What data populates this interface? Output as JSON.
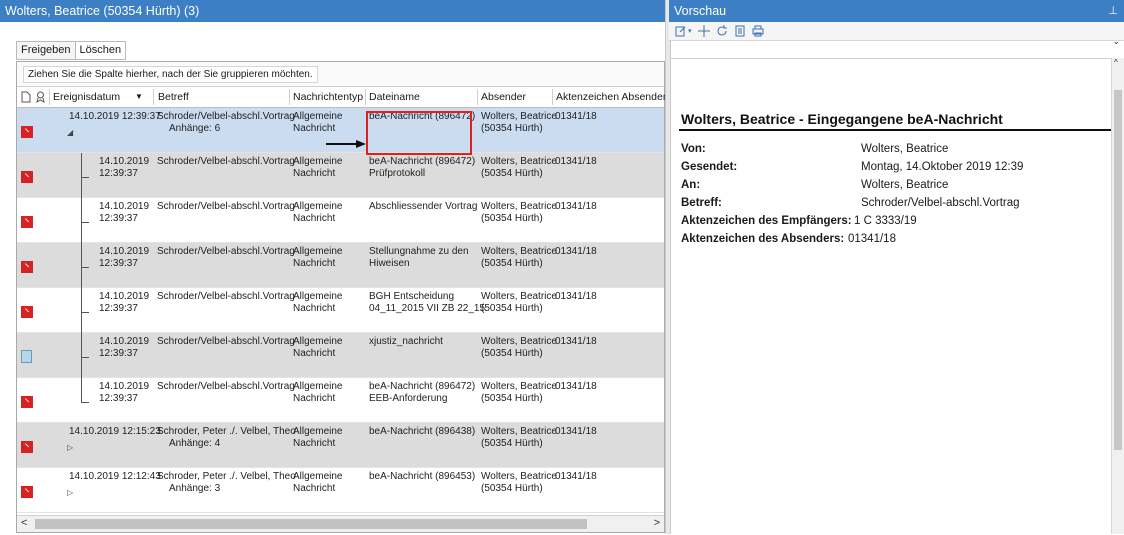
{
  "left_title": "Wolters, Beatrice (50354 Hürth) (3)",
  "right_title": "Vorschau",
  "toolbar": {
    "freigeben": "Freigeben",
    "loeschen": "Löschen"
  },
  "group_hint": "Ziehen Sie die Spalte hierher, nach der Sie gruppieren möchten.",
  "columns": {
    "ereignisdatum": "Ereignisdatum",
    "betreff": "Betreff",
    "nachrichtentyp": "Nachrichtentyp",
    "dateiname": "Dateiname",
    "absender": "Absender",
    "aktenzeichen": "Aktenzeichen Absender"
  },
  "rows": [
    {
      "date1": "14.10.2019 12:39:37",
      "date2": "",
      "betreff1": "Schroder/Velbel-abschl.Vortrag",
      "betreff2": "Anhänge: 6",
      "typ1": "Allgemeine",
      "typ2": "Nachricht",
      "datei1": "beA-Nachricht (896472)",
      "datei2": "",
      "abs1": "Wolters, Beatrice",
      "abs2": "(50354 Hürth)",
      "az": "01341/18",
      "icon": "pdf",
      "style": "sel",
      "level": 0
    },
    {
      "date1": "14.10.2019",
      "date2": "12:39:37",
      "betreff1": "Schroder/Velbel-abschl.Vortrag",
      "betreff2": "",
      "typ1": "Allgemeine",
      "typ2": "Nachricht",
      "datei1": "beA-Nachricht (896472)",
      "datei2": "Prüfprotokoll",
      "abs1": "Wolters, Beatrice",
      "abs2": "(50354 Hürth)",
      "az": "01341/18",
      "icon": "pdf",
      "style": "g",
      "level": 1
    },
    {
      "date1": "14.10.2019",
      "date2": "12:39:37",
      "betreff1": "Schroder/Velbel-abschl.Vortrag",
      "betreff2": "",
      "typ1": "Allgemeine",
      "typ2": "Nachricht",
      "datei1": "Abschliessender Vortrag",
      "datei2": "",
      "abs1": "Wolters, Beatrice",
      "abs2": "(50354 Hürth)",
      "az": "01341/18",
      "icon": "pdf",
      "style": "w",
      "level": 1
    },
    {
      "date1": "14.10.2019",
      "date2": "12:39:37",
      "betreff1": "Schroder/Velbel-abschl.Vortrag",
      "betreff2": "",
      "typ1": "Allgemeine",
      "typ2": "Nachricht",
      "datei1": "Stellungnahme zu den",
      "datei2": "Hiweisen",
      "abs1": "Wolters, Beatrice",
      "abs2": "(50354 Hürth)",
      "az": "01341/18",
      "icon": "pdf",
      "style": "g",
      "level": 1
    },
    {
      "date1": "14.10.2019",
      "date2": "12:39:37",
      "betreff1": "Schroder/Velbel-abschl.Vortrag",
      "betreff2": "",
      "typ1": "Allgemeine",
      "typ2": "Nachricht",
      "datei1": "BGH Entscheidung",
      "datei2": "04_11_2015 VII ZB 22_15",
      "abs1": "Wolters, Beatrice",
      "abs2": "(50354 Hürth)",
      "az": "01341/18",
      "icon": "pdf",
      "style": "w",
      "level": 1
    },
    {
      "date1": "14.10.2019",
      "date2": "12:39:37",
      "betreff1": "Schroder/Velbel-abschl.Vortrag",
      "betreff2": "",
      "typ1": "Allgemeine",
      "typ2": "Nachricht",
      "datei1": "xjustiz_nachricht",
      "datei2": "",
      "abs1": "Wolters, Beatrice",
      "abs2": "(50354 Hürth)",
      "az": "01341/18",
      "icon": "xml",
      "style": "g",
      "level": 1
    },
    {
      "date1": "14.10.2019",
      "date2": "12:39:37",
      "betreff1": "Schroder/Velbel-abschl.Vortrag",
      "betreff2": "",
      "typ1": "Allgemeine",
      "typ2": "Nachricht",
      "datei1": "beA-Nachricht (896472)",
      "datei2": "EEB-Anforderung",
      "abs1": "Wolters, Beatrice",
      "abs2": "(50354 Hürth)",
      "az": "01341/18",
      "icon": "pdf",
      "style": "w",
      "level": 1
    },
    {
      "date1": "14.10.2019 12:15:23",
      "date2": "",
      "betreff1": "Schroder, Peter ./. Velbel, Theo",
      "betreff2": "Anhänge: 4",
      "typ1": "Allgemeine",
      "typ2": "Nachricht",
      "datei1": "beA-Nachricht (896438)",
      "datei2": "",
      "abs1": "Wolters, Beatrice",
      "abs2": "(50354 Hürth)",
      "az": "01341/18",
      "icon": "pdf",
      "style": "g",
      "level": 0
    },
    {
      "date1": "14.10.2019 12:12:43",
      "date2": "",
      "betreff1": "Schroder, Peter ./. Velbel, Theo",
      "betreff2": "Anhänge: 3",
      "typ1": "Allgemeine",
      "typ2": "Nachricht",
      "datei1": "beA-Nachricht (896453)",
      "datei2": "",
      "abs1": "Wolters, Beatrice",
      "abs2": "(50354 Hürth)",
      "az": "01341/18",
      "icon": "pdf",
      "style": "w",
      "level": 0
    }
  ],
  "preview": {
    "title": "Wolters, Beatrice - Eingegangene beA-Nachricht",
    "fields": [
      {
        "k": "Von:",
        "v": "Wolters, Beatrice"
      },
      {
        "k": "Gesendet:",
        "v": "Montag, 14.Oktober 2019 12:39"
      },
      {
        "k": "An:",
        "v": "Wolters, Beatrice"
      },
      {
        "k": "Betreff:",
        "v": "Schroder/Velbel-abschl.Vortrag"
      },
      {
        "k": "Aktenzeichen des Empfängers:",
        "v": "1 C 3333/19"
      },
      {
        "k": "Aktenzeichen des Absenders:",
        "v": "01341/18"
      }
    ]
  }
}
